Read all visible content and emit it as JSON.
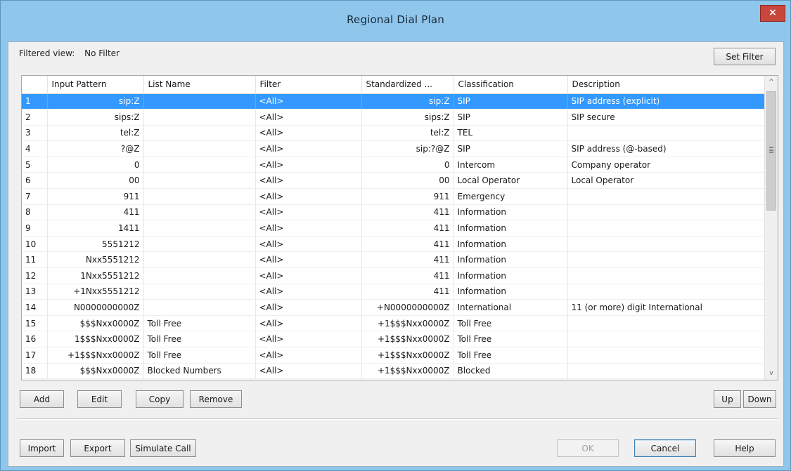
{
  "window": {
    "title": "Regional Dial Plan",
    "close_glyph": "×"
  },
  "filter": {
    "label": "Filtered view:",
    "value": "No Filter",
    "set_filter_label": "Set Filter"
  },
  "table": {
    "columns": [
      "",
      "Input Pattern",
      "List Name",
      "Filter",
      "Standardized ...",
      "Classification",
      "Description"
    ],
    "rows": [
      [
        "1",
        "sip:Z",
        "",
        "<All>",
        "sip:Z",
        "SIP",
        "SIP address (explicit)"
      ],
      [
        "2",
        "sips:Z",
        "",
        "<All>",
        "sips:Z",
        "SIP",
        "SIP secure"
      ],
      [
        "3",
        "tel:Z",
        "",
        "<All>",
        "tel:Z",
        "TEL",
        ""
      ],
      [
        "4",
        "?@Z",
        "",
        "<All>",
        "sip:?@Z",
        "SIP",
        "SIP address (@-based)"
      ],
      [
        "5",
        "0",
        "",
        "<All>",
        "0",
        "Intercom",
        "Company operator"
      ],
      [
        "6",
        "00",
        "",
        "<All>",
        "00",
        "Local Operator",
        "Local Operator"
      ],
      [
        "7",
        "911",
        "",
        "<All>",
        "911",
        "Emergency",
        ""
      ],
      [
        "8",
        "411",
        "",
        "<All>",
        "411",
        "Information",
        ""
      ],
      [
        "9",
        "1411",
        "",
        "<All>",
        "411",
        "Information",
        ""
      ],
      [
        "10",
        "5551212",
        "",
        "<All>",
        "411",
        "Information",
        ""
      ],
      [
        "11",
        "Nxx5551212",
        "",
        "<All>",
        "411",
        "Information",
        ""
      ],
      [
        "12",
        "1Nxx5551212",
        "",
        "<All>",
        "411",
        "Information",
        ""
      ],
      [
        "13",
        "+1Nxx5551212",
        "",
        "<All>",
        "411",
        "Information",
        ""
      ],
      [
        "14",
        "N0000000000Z",
        "",
        "<All>",
        "+N0000000000Z",
        "International",
        "11 (or more) digit International"
      ],
      [
        "15",
        "$$$Nxx0000Z",
        "Toll Free",
        "<All>",
        "+1$$$Nxx0000Z",
        "Toll Free",
        ""
      ],
      [
        "16",
        "1$$$Nxx0000Z",
        "Toll Free",
        "<All>",
        "+1$$$Nxx0000Z",
        "Toll Free",
        ""
      ],
      [
        "17",
        "+1$$$Nxx0000Z",
        "Toll Free",
        "<All>",
        "+1$$$Nxx0000Z",
        "Toll Free",
        ""
      ],
      [
        "18",
        "$$$Nxx0000Z",
        "Blocked Numbers",
        "<All>",
        "+1$$$Nxx0000Z",
        "Blocked",
        ""
      ]
    ],
    "selected_row": 0
  },
  "scrollbar": {
    "up_icon": "^",
    "down_icon": "v"
  },
  "row_actions": {
    "add": "Add",
    "edit": "Edit",
    "copy": "Copy",
    "remove": "Remove",
    "up": "Up",
    "down": "Down"
  },
  "footer": {
    "import": "Import",
    "export": "Export",
    "simulate": "Simulate Call",
    "ok": "OK",
    "cancel": "Cancel",
    "help": "Help"
  }
}
